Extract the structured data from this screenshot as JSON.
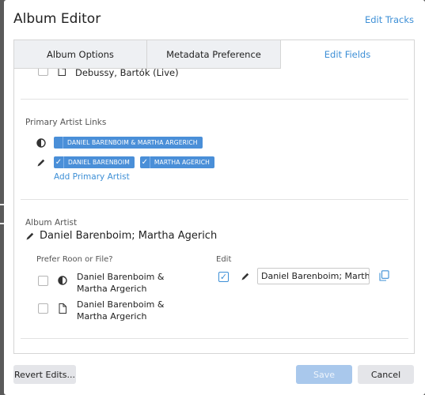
{
  "dialog": {
    "title": "Album Editor",
    "edit_tracks_link": "Edit Tracks"
  },
  "tabs": [
    {
      "label": "Album Options"
    },
    {
      "label": "Metadata Preference"
    },
    {
      "label": "Edit Fields",
      "active": true
    }
  ],
  "top_partial_row": {
    "text": "Debussy, Bartók (Live)"
  },
  "primary_artist_links": {
    "label": "Primary Artist Links",
    "roon_chip": "DANIEL BARENBOIM & MARTHA ARGERICH",
    "file_chips": [
      "DANIEL BARENBOIM",
      "MARTHA AGERICH"
    ],
    "add_link": "Add Primary Artist"
  },
  "album_artist": {
    "label": "Album Artist",
    "value": "Daniel Barenboim; Martha Agerich",
    "prefer_label": "Prefer Roon or File?",
    "edit_label": "Edit",
    "roon_option": "Daniel Barenboim & Martha Argerich",
    "file_option": "Daniel Barenboim & Martha Argerich",
    "edit_value": "Daniel Barenboim; Martha Agerich",
    "edit_checked": true
  },
  "footer": {
    "revert_label": "Revert Edits...",
    "save_label": "Save",
    "cancel_label": "Cancel"
  },
  "colors": {
    "accent": "#3d8fd6",
    "chip": "#4a8fd8",
    "save_disabled": "#a9c8ec"
  }
}
